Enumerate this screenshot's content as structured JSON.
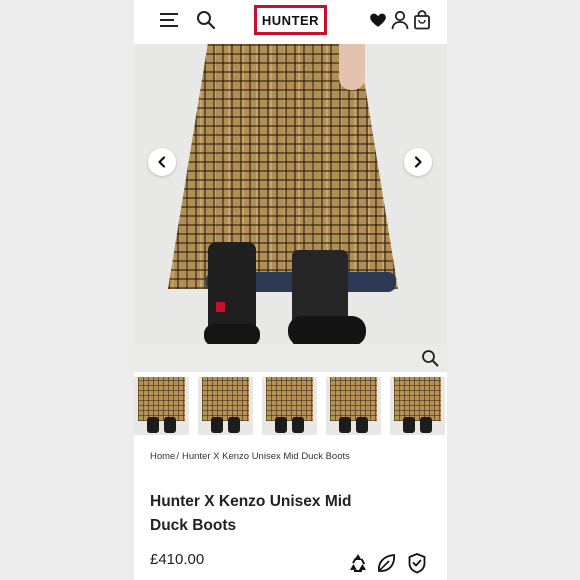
{
  "header": {
    "logo_text": "HUNTER",
    "brand_color": "#c8102e"
  },
  "icons": {
    "menu": "hamburger-menu-icon",
    "search": "search-icon",
    "wishlist": "heart-icon",
    "account": "user-icon",
    "cart": "shopping-bag-icon",
    "prev": "chevron-left-icon",
    "next": "chevron-right-icon",
    "zoom": "zoom-icon",
    "recycle": "recycle-icon",
    "leaf": "leaf-icon",
    "shield": "shield-check-icon"
  },
  "breadcrumb": {
    "home": "Home",
    "separator": "/",
    "current": "Hunter X Kenzo Unisex Mid Duck Boots"
  },
  "product": {
    "title_line1": "Hunter X Kenzo Unisex Mid",
    "title_line2": "Duck Boots",
    "price": "£410.00"
  },
  "gallery": {
    "thumbnail_count": 5
  }
}
